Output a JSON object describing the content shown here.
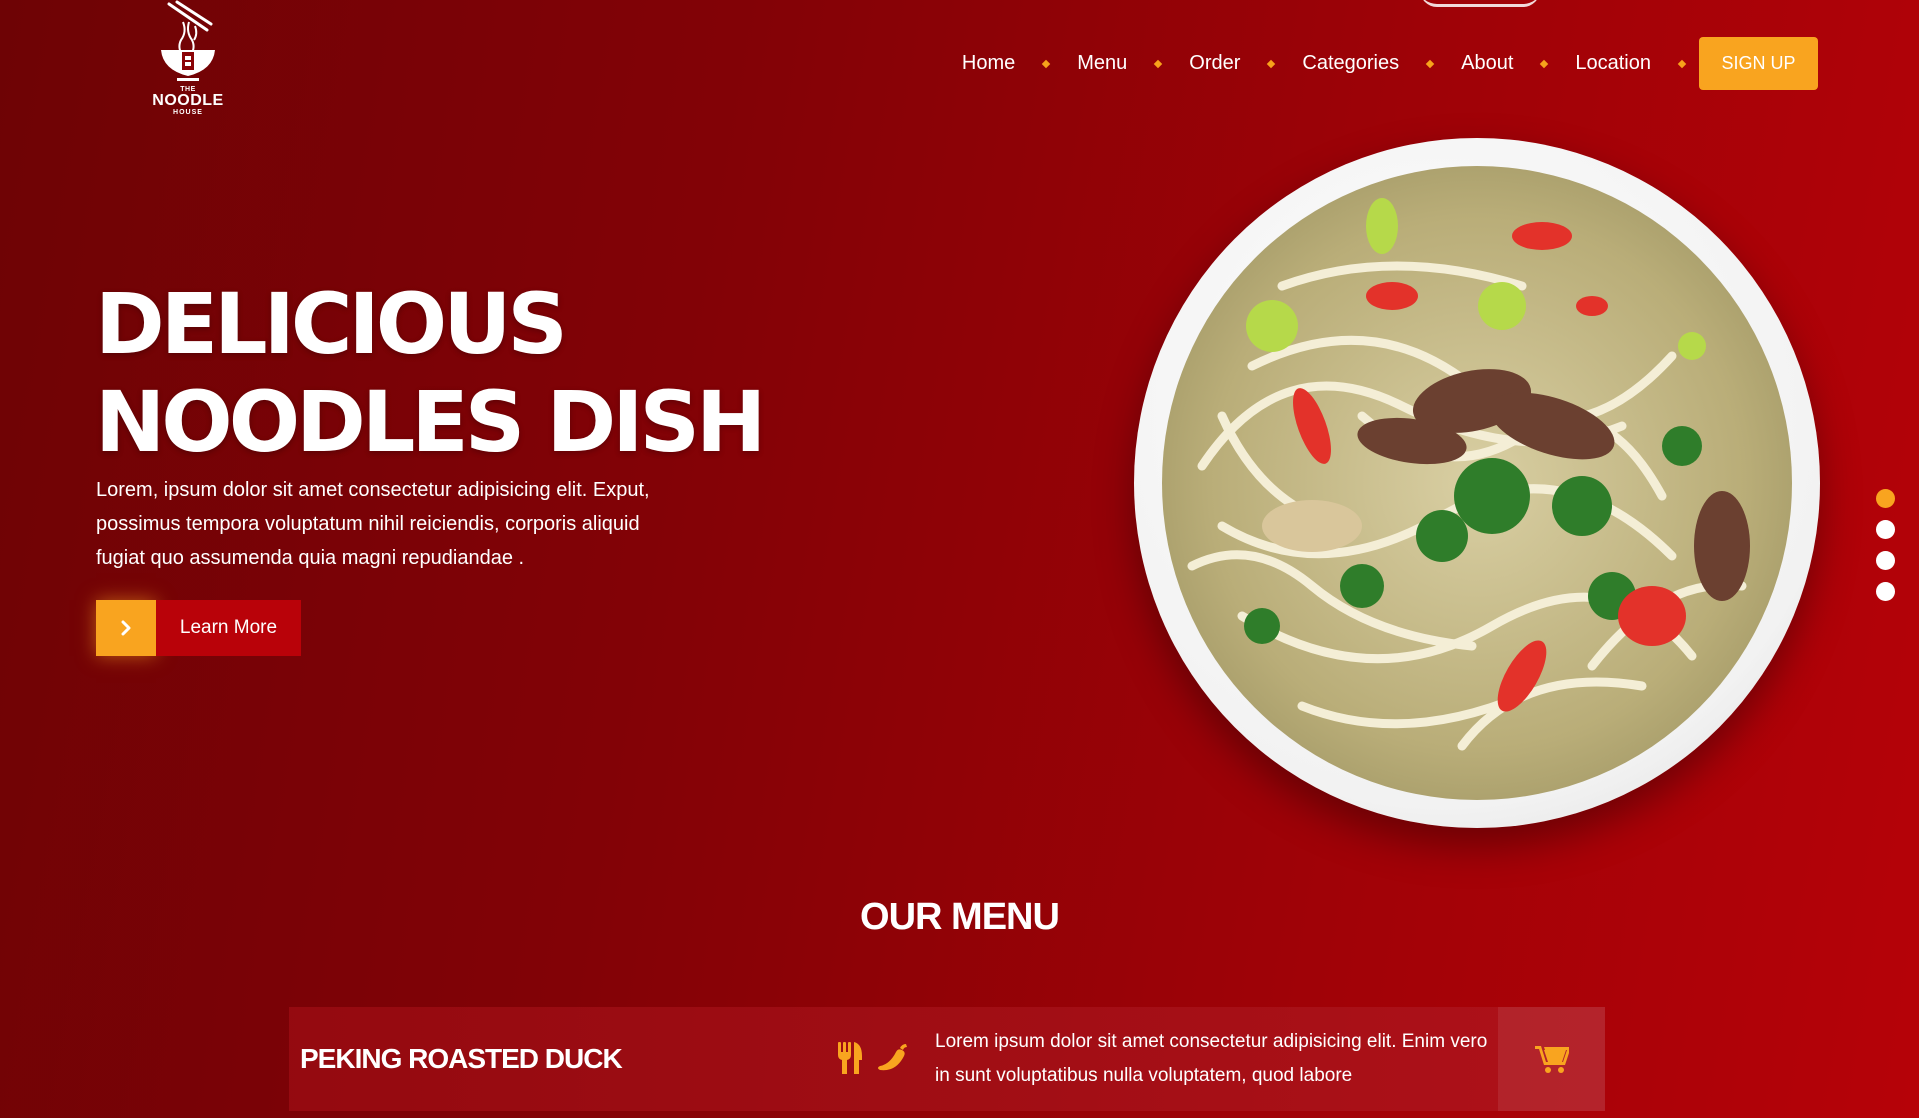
{
  "brand": {
    "logo_line1": "THE",
    "logo_line2": "NOODLE",
    "logo_line3": "HOUSE"
  },
  "nav": {
    "items": [
      {
        "label": "Home"
      },
      {
        "label": "Menu"
      },
      {
        "label": "Order"
      },
      {
        "label": "Categories"
      },
      {
        "label": "About"
      },
      {
        "label": "Location"
      }
    ],
    "signup_label": "SIGN UP"
  },
  "hero": {
    "title_line1": "DELICIOUS",
    "title_line2": "NOODLES DISH",
    "description": "Lorem, ipsum dolor sit amet consectetur adipisicing elit. Exput, possimus tempora voluptatum nihil reiciendis, corporis aliquid fugiat quo assumenda quia magni repudiandae .",
    "cta_label": "Learn More",
    "slide_active": 1,
    "slide_count": 4
  },
  "menu_section": {
    "title": "OUR MENU",
    "items": [
      {
        "name": "PEKING ROASTED DUCK",
        "description": "Lorem ipsum dolor sit amet consectetur adipisicing elit. Enim vero in sunt voluptatibus nulla voluptatem, quod labore"
      }
    ]
  },
  "colors": {
    "accent": "#f9a41f",
    "background_dark": "#6e0305",
    "background_light": "#b60208"
  },
  "icons": {
    "cta": "chevron-right-icon",
    "menu_item_1": "utensils-icon",
    "menu_item_2": "chili-pepper-icon",
    "cart": "shopping-cart-icon"
  }
}
